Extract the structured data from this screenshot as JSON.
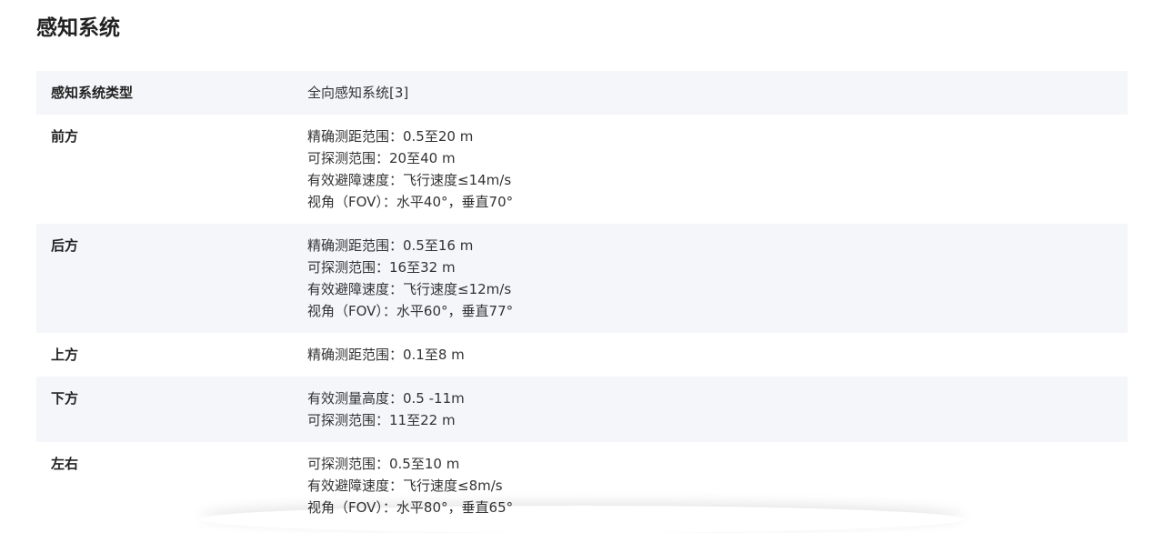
{
  "page": {
    "title": "感知系统"
  },
  "table": {
    "rows": [
      {
        "label": "感知系统类型",
        "values": [
          "全向感知系统[3]"
        ]
      },
      {
        "label": "前方",
        "values": [
          "精确测距范围：0.5至20 m",
          "可探测范围：20至40 m",
          "有效避障速度：飞行速度≤14m/s",
          "视角（FOV）：水平40°，垂直70°"
        ]
      },
      {
        "label": "后方",
        "values": [
          "精确测距范围：0.5至16 m",
          "可探测范围：16至32 m",
          "有效避障速度：飞行速度≤12m/s",
          "视角（FOV）：水平60°，垂直77°"
        ]
      },
      {
        "label": "上方",
        "values": [
          "精确测距范围：0.1至8 m"
        ]
      },
      {
        "label": "下方",
        "values": [
          "有效测量高度：0.5 -11m",
          "可探测范围：11至22 m"
        ]
      },
      {
        "label": "左右",
        "values": [
          "可探测范围：0.5至10 m",
          "有效避障速度：飞行速度≤8m/s",
          "视角（FOV）：水平80°，垂直65°"
        ]
      }
    ]
  },
  "colors": {
    "row_shade": "#f5f6fa",
    "text": "#333333",
    "heading": "#222222"
  }
}
